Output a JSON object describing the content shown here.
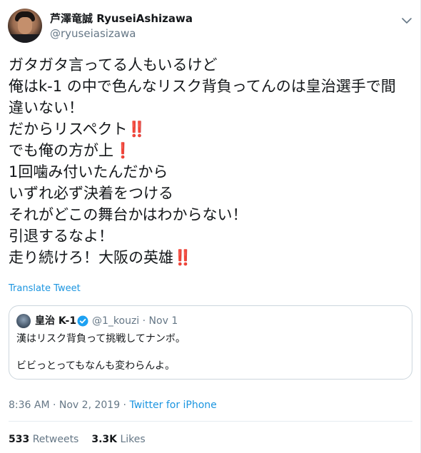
{
  "author": {
    "display_name": "芦澤竜誠 RyuseiAshizawa",
    "handle": "@ryuseiasizawa"
  },
  "tweet": {
    "lines": [
      {
        "text": "ガタガタ言ってる人もいるけど",
        "suffix": ""
      },
      {
        "text": "俺はk-1 の中で色んなリスク背負ってんのは皇治選手で間",
        "suffix": ""
      },
      {
        "text": "違いない！",
        "suffix": ""
      },
      {
        "text": "だからリスペクト",
        "suffix": "‼️"
      },
      {
        "text": "でも俺の方が上",
        "suffix": "❗"
      },
      {
        "text": "1回噛み付いたんだから",
        "suffix": ""
      },
      {
        "text": "いずれ必ず決着をつける",
        "suffix": ""
      },
      {
        "text": "それがどこの舞台かはわからない！",
        "suffix": ""
      },
      {
        "text": "引退するなよ！",
        "suffix": ""
      },
      {
        "text": "走り続けろ！大阪の英雄",
        "suffix": "‼️"
      }
    ],
    "translate_label": "Translate Tweet"
  },
  "quoted": {
    "name": "皇治 K-1",
    "handle_and_date": "@1_kouzi · Nov 1",
    "line1": "漢はリスク背負って挑戦してナンボ。",
    "line2": "ビビっとってもなんも変わらんよ。"
  },
  "meta": {
    "timestamp": "8:36 AM · Nov 2, 2019 · ",
    "source": "Twitter for iPhone"
  },
  "stats": {
    "retweets_count": "533",
    "retweets_label": "Retweets",
    "likes_count": "3.3K",
    "likes_label": "Likes"
  },
  "colors": {
    "accent": "#1b95e0",
    "muted": "#657786",
    "text": "#14171a",
    "emoji_red": "#e0245e"
  },
  "icons": [
    "chevron-down-icon",
    "verified-badge-icon"
  ]
}
